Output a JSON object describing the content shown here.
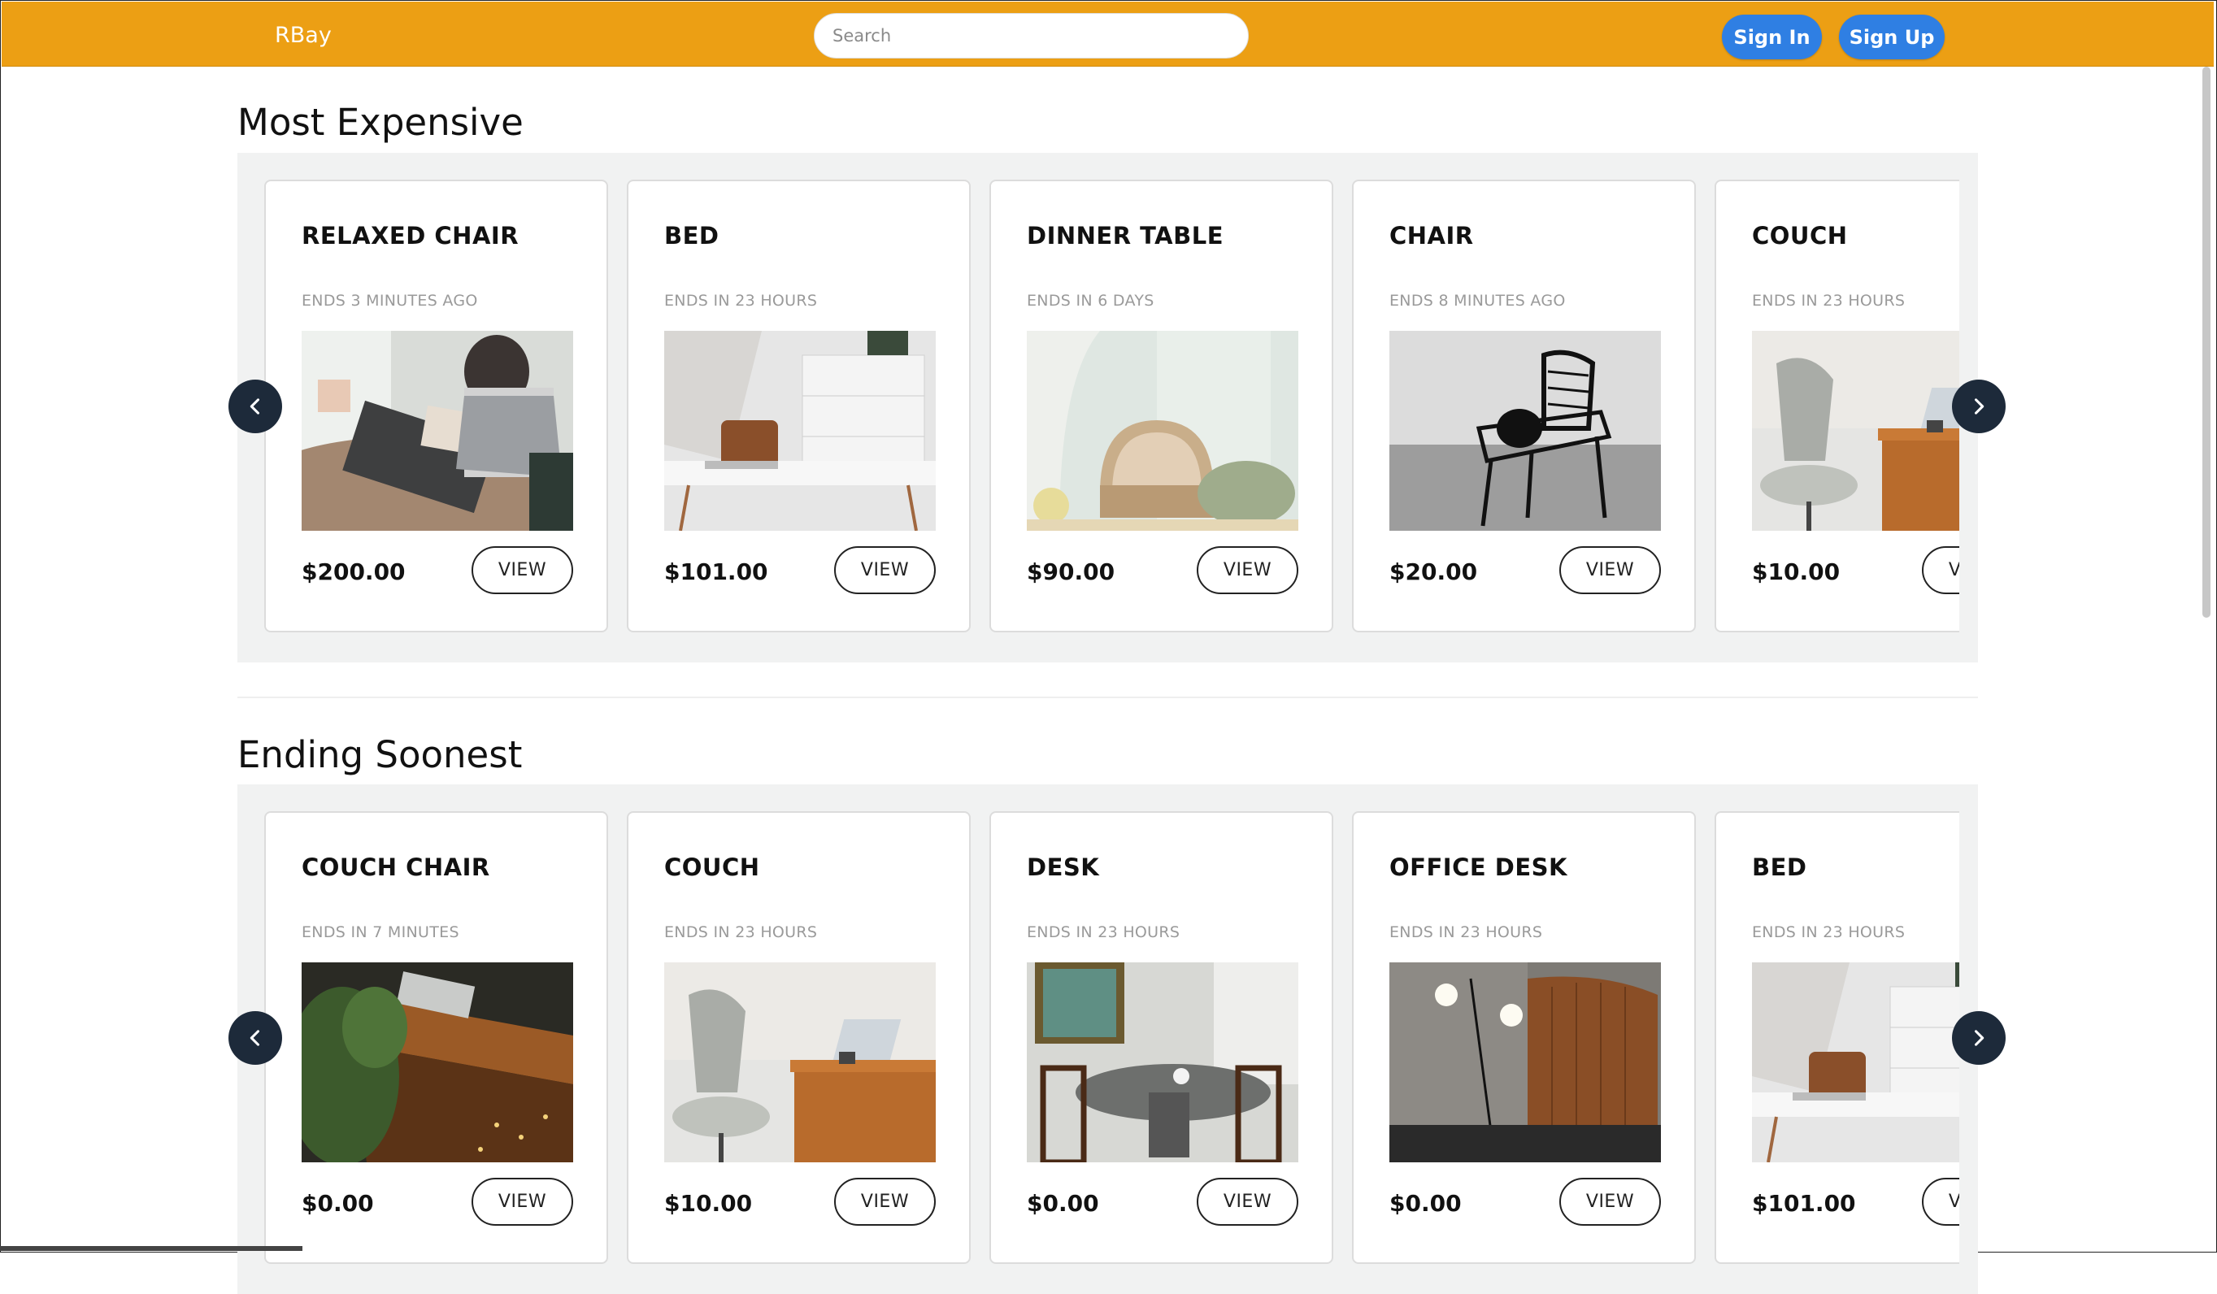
{
  "header": {
    "brand": "RBay",
    "search_placeholder": "Search",
    "signin_label": "Sign In",
    "signup_label": "Sign Up"
  },
  "sections": [
    {
      "title": "Most Expensive",
      "items": [
        {
          "title": "RELAXED CHAIR",
          "ends": "ENDS 3 MINUTES AGO",
          "price": "$200.00",
          "view": "VIEW",
          "image": "woman-reading-table"
        },
        {
          "title": "BED",
          "ends": "ENDS IN 23 HOURS",
          "price": "$101.00",
          "view": "VIEW",
          "image": "white-desk-dresser"
        },
        {
          "title": "DINNER TABLE",
          "ends": "ENDS IN 6 DAYS",
          "price": "$90.00",
          "view": "VIEW",
          "image": "ornate-armchair"
        },
        {
          "title": "CHAIR",
          "ends": "ENDS 8 MINUTES AGO",
          "price": "$20.00",
          "view": "VIEW",
          "image": "black-metal-chair"
        },
        {
          "title": "COUCH",
          "ends": "ENDS IN 23 HOURS",
          "price": "$10.00",
          "view": "VIEW",
          "image": "office-chair-desk"
        }
      ]
    },
    {
      "title": "Ending Soonest",
      "items": [
        {
          "title": "COUCH CHAIR",
          "ends": "ENDS IN 7 MINUTES",
          "price": "$0.00",
          "view": "VIEW",
          "image": "wood-desk-plants"
        },
        {
          "title": "COUCH",
          "ends": "ENDS IN 23 HOURS",
          "price": "$10.00",
          "view": "VIEW",
          "image": "office-chair-desk"
        },
        {
          "title": "DESK",
          "ends": "ENDS IN 23 HOURS",
          "price": "$0.00",
          "view": "VIEW",
          "image": "round-dining-table"
        },
        {
          "title": "OFFICE DESK",
          "ends": "ENDS IN 23 HOURS",
          "price": "$0.00",
          "view": "VIEW",
          "image": "wood-cabinet-lamp"
        },
        {
          "title": "BED",
          "ends": "ENDS IN 23 HOURS",
          "price": "$101.00",
          "view": "VIEW",
          "image": "white-desk-dresser"
        }
      ]
    }
  ],
  "icons": {
    "prev": "chevron-left-icon",
    "next": "chevron-right-icon"
  },
  "colors": {
    "navbar": "#ec9f14",
    "button": "#2f7fe3",
    "arrow": "#1d2a3a",
    "carousel_bg": "#f1f2f2"
  }
}
